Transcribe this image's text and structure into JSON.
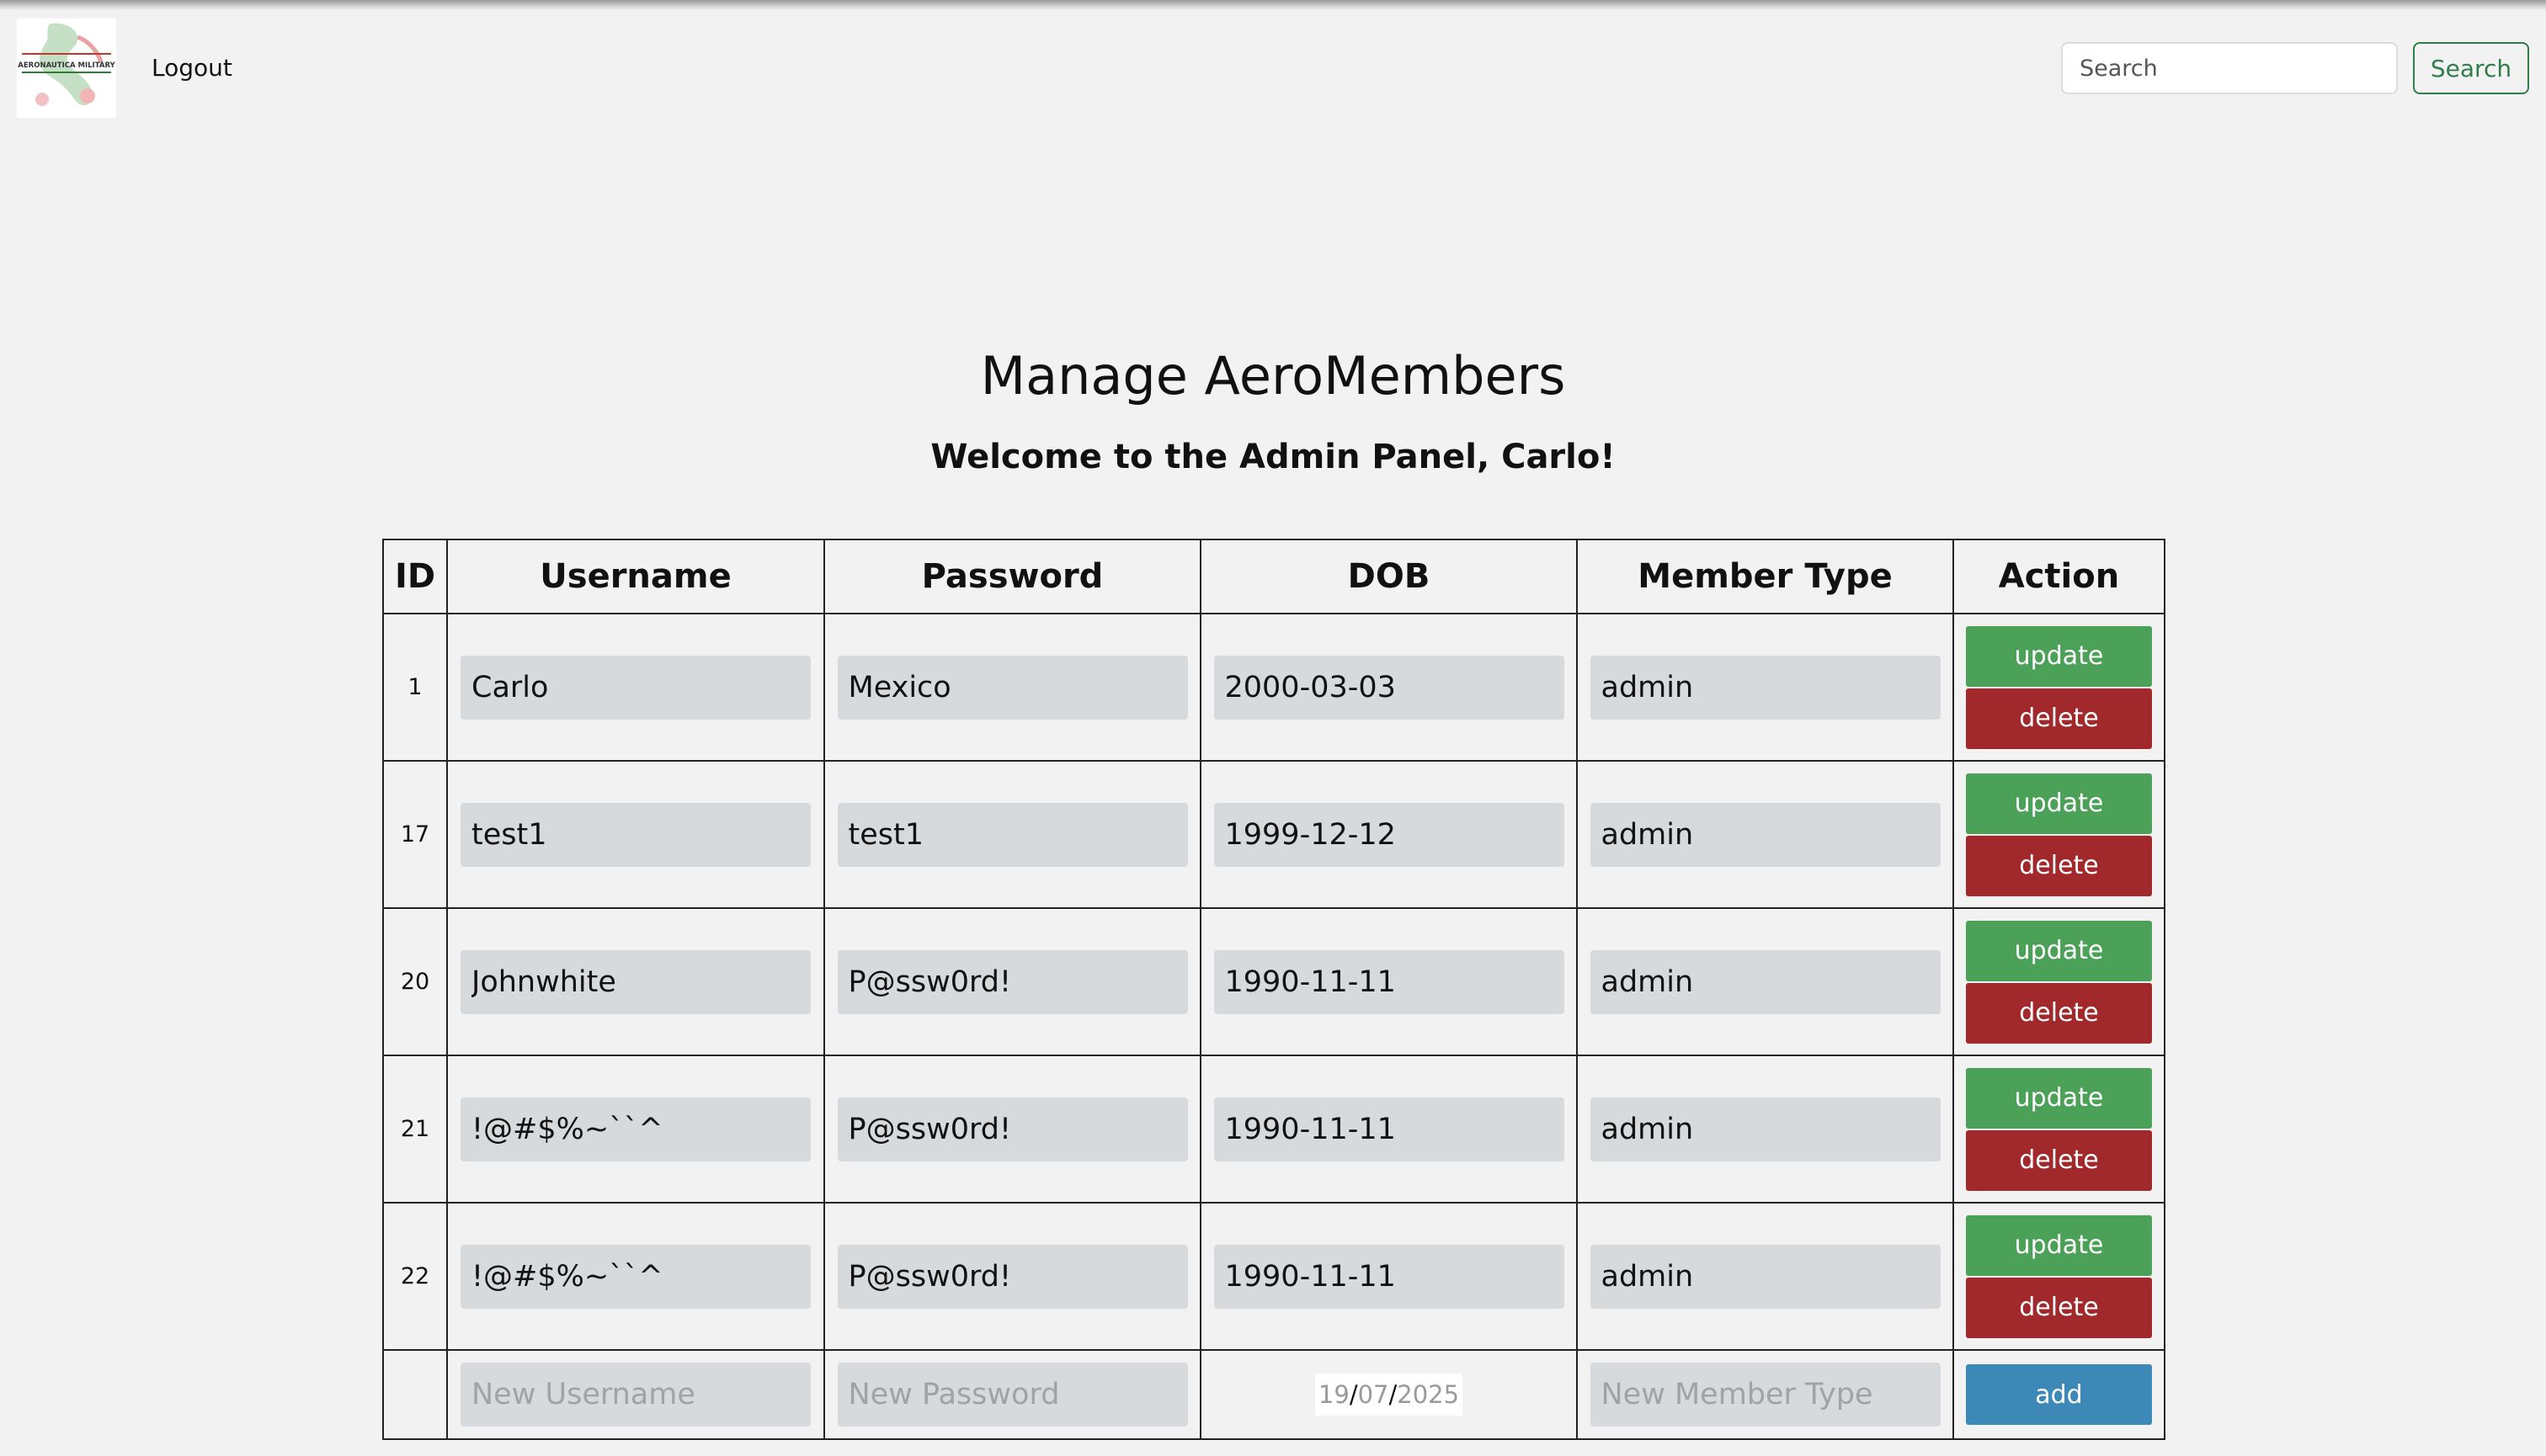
{
  "header": {
    "logout_label": "Logout",
    "search": {
      "placeholder": "Search",
      "button_label": "Search"
    },
    "logo": {
      "text": "AERONAUTICA MILITARY"
    }
  },
  "main": {
    "title": "Manage AeroMembers",
    "welcome": "Welcome to the Admin Panel, Carlo!"
  },
  "table": {
    "columns": [
      "ID",
      "Username",
      "Password",
      "DOB",
      "Member Type",
      "Action"
    ],
    "rows": [
      {
        "id": "1",
        "username": "Carlo",
        "password": "Mexico",
        "dob": "2000-03-03",
        "member_type": "admin"
      },
      {
        "id": "17",
        "username": "test1",
        "password": "test1",
        "dob": "1999-12-12",
        "member_type": "admin"
      },
      {
        "id": "20",
        "username": "Johnwhite",
        "password": "P@ssw0rd!",
        "dob": "1990-11-11",
        "member_type": "admin"
      },
      {
        "id": "21",
        "username": "!@#$%~``^",
        "password": "P@ssw0rd!",
        "dob": "1990-11-11",
        "member_type": "admin"
      },
      {
        "id": "22",
        "username": "!@#$%~``^",
        "password": "P@ssw0rd!",
        "dob": "1990-11-11",
        "member_type": "admin"
      }
    ],
    "update_label": "update",
    "delete_label": "delete",
    "new_row": {
      "username_placeholder": "New Username",
      "password_placeholder": "New Password",
      "member_type_placeholder": "New Member Type",
      "date": {
        "day": "19",
        "month": "07",
        "year": "2025"
      },
      "add_label": "add"
    }
  },
  "colors": {
    "update": "#4aa157",
    "delete": "#a1282b",
    "add": "#3c89b8",
    "search_outline": "#2f7d4a"
  }
}
